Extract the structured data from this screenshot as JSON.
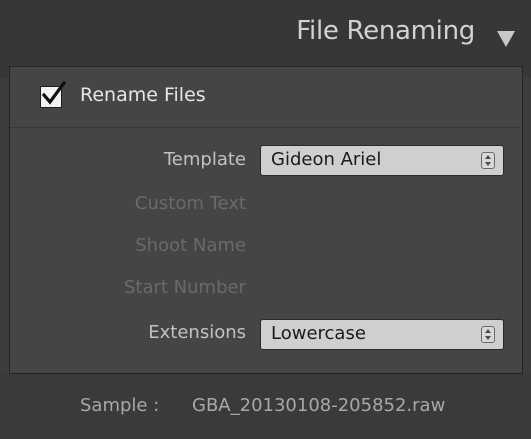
{
  "header": {
    "title": "File Renaming",
    "collapse_icon": "triangle-down-icon"
  },
  "rename": {
    "label": "Rename Files",
    "checked": true
  },
  "fields": {
    "template": {
      "label": "Template",
      "value": "Gideon Ariel",
      "enabled": true
    },
    "custom_text": {
      "label": "Custom Text",
      "enabled": false
    },
    "shoot_name": {
      "label": "Shoot Name",
      "enabled": false
    },
    "start_number": {
      "label": "Start Number",
      "enabled": false
    },
    "extensions": {
      "label": "Extensions",
      "value": "Lowercase",
      "enabled": true
    }
  },
  "sample": {
    "label": "Sample :",
    "value": "GBA_20130108-205852.raw"
  },
  "colors": {
    "panel_bg": "#3d3d3d",
    "body_bg": "#454545",
    "select_bg": "#cfcfcf",
    "enabled_label": "#c2c2c2",
    "disabled_label": "#6a6a6a"
  }
}
